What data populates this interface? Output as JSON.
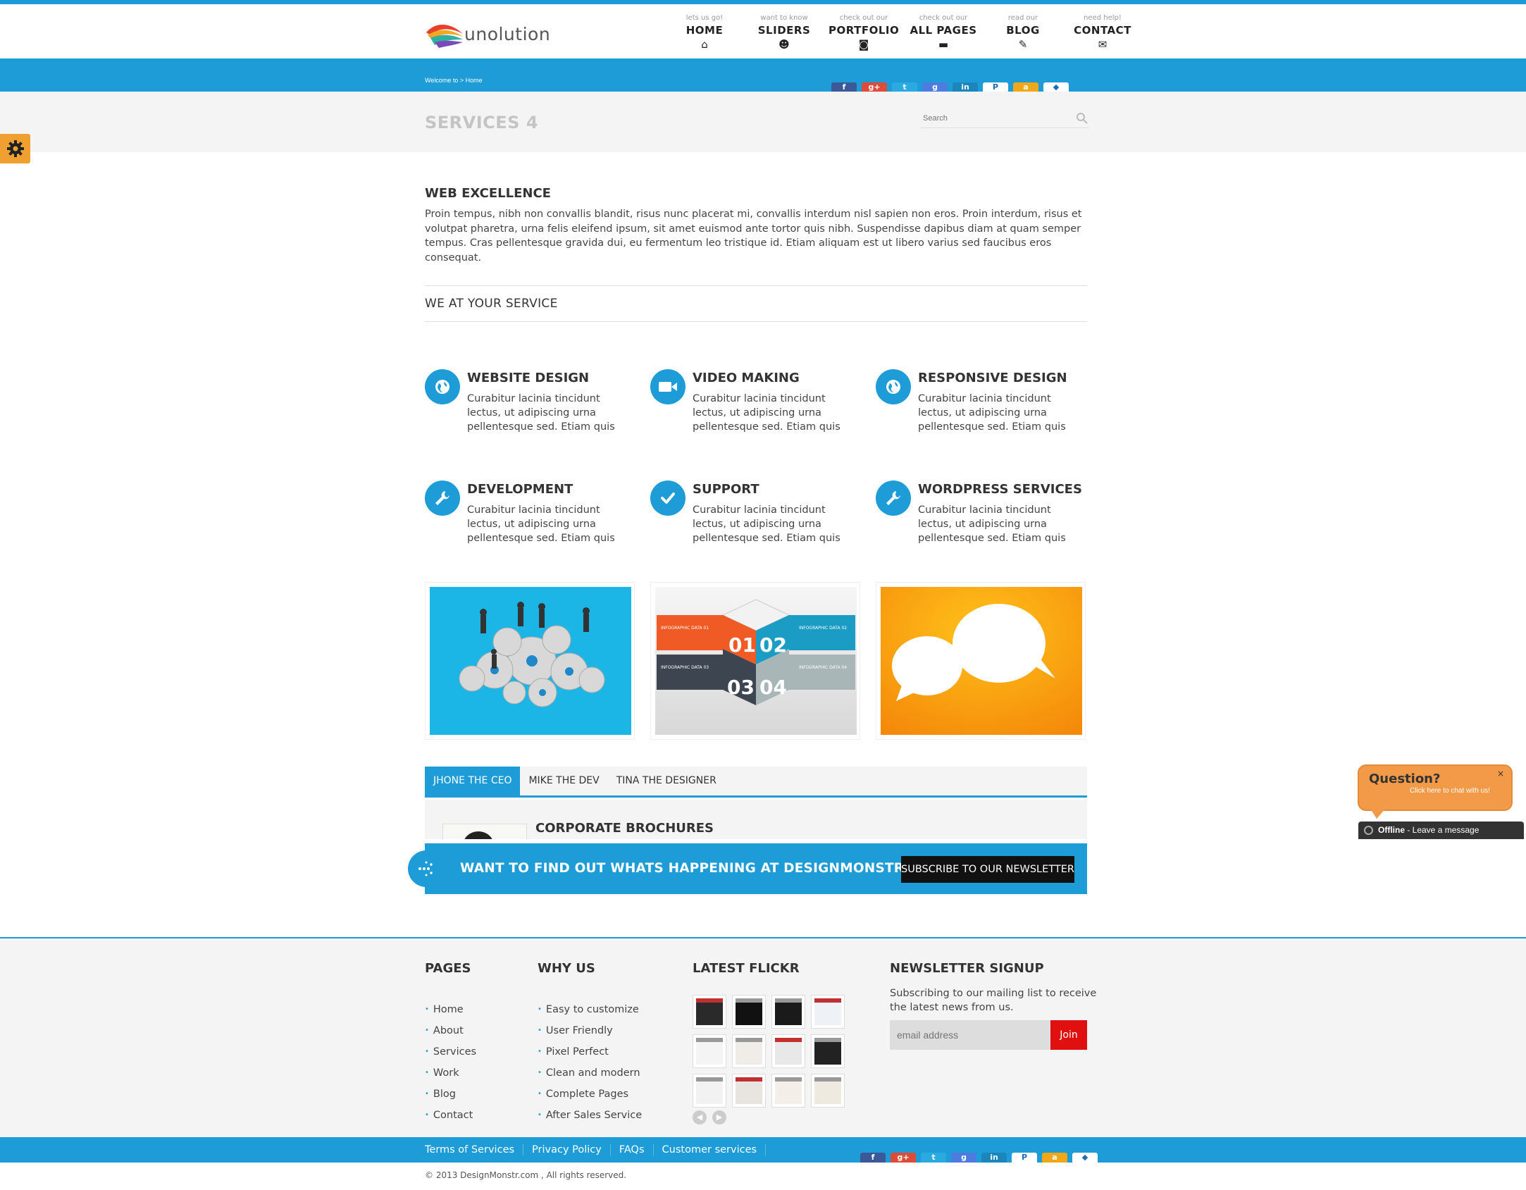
{
  "header": {
    "logo_text": "unolution",
    "nav": [
      {
        "sub": "lets us go!",
        "label": "HOME",
        "icon": "home-icon"
      },
      {
        "sub": "want to know",
        "label": "SLIDERS",
        "icon": "users-icon"
      },
      {
        "sub": "check out our",
        "label": "PORTFOLIO",
        "icon": "camera-icon"
      },
      {
        "sub": "check out our",
        "label": "ALL PAGES",
        "icon": "briefcase-icon"
      },
      {
        "sub": "read our",
        "label": "BLOG",
        "icon": "pencil-icon"
      },
      {
        "sub": "need help!",
        "label": "CONTACT",
        "icon": "envelope-icon"
      }
    ]
  },
  "breadcrumb": "Welcome to > Home",
  "social": [
    {
      "icon": "facebook-icon",
      "glyph": "f",
      "color": "#3b5998"
    },
    {
      "icon": "googleplus-icon",
      "glyph": "g+",
      "color": "#dd4b39"
    },
    {
      "icon": "twitter-icon",
      "glyph": "t",
      "color": "#2ba9e1"
    },
    {
      "icon": "google-icon",
      "glyph": "g",
      "color": "#4e7be0"
    },
    {
      "icon": "linkedin-icon",
      "glyph": "in",
      "color": "#1b86bc"
    },
    {
      "icon": "paypal-icon",
      "glyph": "P",
      "color": "#ffffff"
    },
    {
      "icon": "amazon-icon",
      "glyph": "a",
      "color": "#f0a818"
    },
    {
      "icon": "dropbox-icon",
      "glyph": "◆",
      "color": "#ffffff"
    }
  ],
  "page_title": "SERVICES 4",
  "search": {
    "placeholder": "Search"
  },
  "intro": {
    "heading": "WEB EXCELLENCE",
    "text": "Proin tempus, nibh non convallis blandit, risus nunc placerat mi, convallis interdum nisl sapien non eros. Proin interdum, risus et volutpat pharetra, urna felis eleifend ipsum, sit amet euismod ante tortor quis nibh. Suspendisse dapibus diam at quam semper tempus. Cras pellentesque gravida dui, eu fermentum leo tristique id. Etiam aliquam est ut libero varius sed faucibus eros consequat."
  },
  "services_heading": "WE AT YOUR SERVICE",
  "services": [
    {
      "title": "WEBSITE DESIGN",
      "icon": "globe-icon",
      "text": "Curabitur lacinia tincidunt lectus, ut adipiscing urna pellentesque sed. Etiam quis"
    },
    {
      "title": "VIDEO MAKING",
      "icon": "video-camera-icon",
      "text": "Curabitur lacinia tincidunt lectus, ut adipiscing urna pellentesque sed. Etiam quis"
    },
    {
      "title": "RESPONSIVE DESIGN",
      "icon": "globe-icon",
      "text": "Curabitur lacinia tincidunt lectus, ut adipiscing urna pellentesque sed. Etiam quis"
    },
    {
      "title": "DEVELOPMENT",
      "icon": "wrench-icon",
      "text": "Curabitur lacinia tincidunt lectus, ut adipiscing urna pellentesque sed. Etiam quis"
    },
    {
      "title": "SUPPORT",
      "icon": "checkmark-icon",
      "text": "Curabitur lacinia tincidunt lectus, ut adipiscing urna pellentesque sed. Etiam quis"
    },
    {
      "title": "WORDPRESS SERVICES",
      "icon": "wrench-icon",
      "text": "Curabitur lacinia tincidunt lectus, ut adipiscing urna pellentesque sed. Etiam quis"
    }
  ],
  "infographic": {
    "n1": "01",
    "n2": "02",
    "n3": "03",
    "n4": "04",
    "label1": "INFOGRAPHIC DATA 01",
    "label2": "INFOGRAPHIC DATA 02",
    "label3": "INFOGRAPHIC DATA 03",
    "label4": "INFOGRAPHIC DATA 04"
  },
  "tabs": [
    "JHONE THE CEO",
    "MIKE THE DEV",
    "TINA THE DESIGNER"
  ],
  "tab_panel_title": "CORPORATE BROCHURES",
  "banner": {
    "text": "WANT TO FIND OUT WHATS HAPPENING AT DESIGNMONSTR.COM",
    "button": "SUBSCRIBE TO OUR NEWSLETTER"
  },
  "chat": {
    "question": "Question?",
    "sub": "Click here to chat with us!",
    "close": "×",
    "status_bold": "Offline",
    "status_rest": " - Leave a message"
  },
  "footer": {
    "pages_title": "PAGES",
    "pages": [
      "Home",
      "About",
      "Services",
      "Work",
      "Blog",
      "Contact"
    ],
    "why_title": "WHY US",
    "why": [
      "Easy to customize",
      "User Friendly",
      "Pixel Perfect",
      "Clean and modern",
      "Complete Pages",
      "After Sales Service"
    ],
    "flickr_title": "LATEST FLICKR",
    "newsletter_title": "NEWSLETTER SIGNUP",
    "newsletter_text": "Subscribing to our mailing list to receive the latest news from us.",
    "email_placeholder": "email address",
    "join": "Join"
  },
  "bottom_links": [
    "Terms of Services",
    "Privacy Policy",
    "FAQs",
    "Customer services"
  ],
  "copyright": "© 2013 DesignMonstr.com , All rights reserved.",
  "colors": {
    "accent": "#1e9cd7",
    "orange": "#f29a48",
    "join_red": "#e01010"
  }
}
